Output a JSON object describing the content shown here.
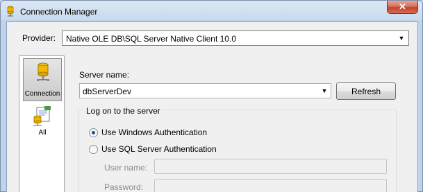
{
  "window": {
    "title": "Connection Manager",
    "close_glyph": "✕"
  },
  "provider": {
    "label": "Provider:",
    "value": "Native OLE DB\\SQL Server Native Client 10.0"
  },
  "nav": {
    "items": [
      {
        "label": "Connection",
        "icon": "database-connection-icon",
        "selected": true
      },
      {
        "label": "All",
        "icon": "all-properties-icon",
        "selected": false
      }
    ]
  },
  "server": {
    "label": "Server name:",
    "value": "dbServerDev",
    "refresh_label": "Refresh"
  },
  "logon": {
    "legend": "Log on to the server",
    "options": [
      {
        "label": "Use Windows Authentication",
        "checked": true
      },
      {
        "label": "Use SQL Server Authentication",
        "checked": false
      }
    ],
    "username_label": "User name:",
    "username_value": "",
    "password_label": "Password:",
    "password_value": ""
  },
  "colors": {
    "title_bar": "#c9daee",
    "client_bg": "#f0f0f0",
    "close_button": "#c4412c",
    "radio_dot": "#1d4f91"
  }
}
